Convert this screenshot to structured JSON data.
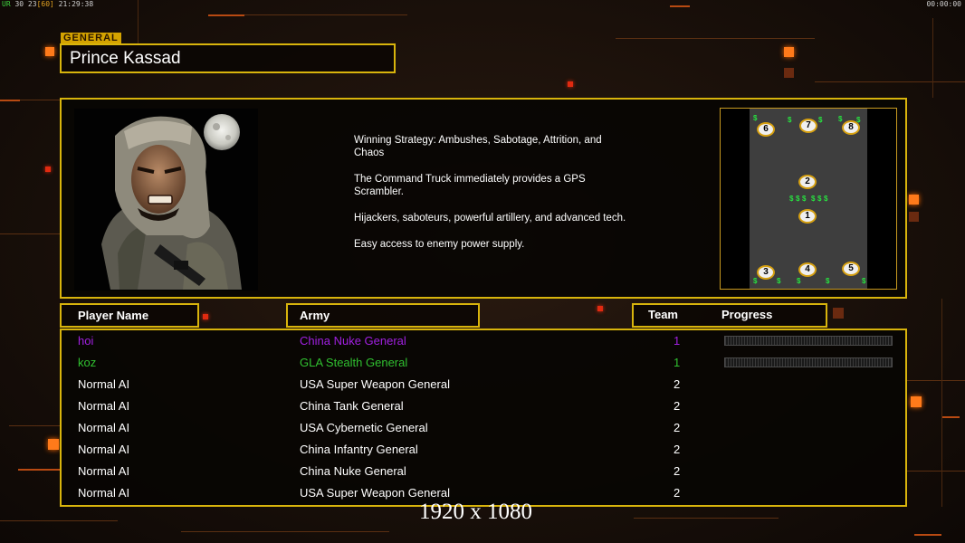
{
  "status_bar": {
    "left_prefix": "UR",
    "left_fps": "30 23",
    "left_fps_cap": "[60]",
    "left_time": "21:29:38",
    "right_timer": "00:00:00"
  },
  "general": {
    "tag": "GENERAL",
    "name": "Prince Kassad",
    "strategy_lines": [
      "Winning Strategy: Ambushes, Sabotage, Attrition, and Chaos",
      "The Command Truck immediately provides a GPS Scrambler.",
      "Hijackers, saboteurs, powerful artillery, and advanced tech.",
      "Easy access to enemy power supply."
    ]
  },
  "minimap": {
    "start_positions": [
      "6",
      "7",
      "8",
      "2",
      "1",
      "3",
      "4",
      "5"
    ],
    "cash_symbol": "$"
  },
  "headers": {
    "player_name": "Player Name",
    "army": "Army",
    "team": "Team",
    "progress": "Progress"
  },
  "players": [
    {
      "name": "hoi",
      "army": "China Nuke General",
      "team": "1",
      "color": "#a020e0",
      "show_progress": true
    },
    {
      "name": "koz",
      "army": "GLA Stealth General",
      "team": "1",
      "color": "#30c030",
      "show_progress": true
    },
    {
      "name": "Normal AI",
      "army": "USA Super Weapon General",
      "team": "2",
      "color": "#ffffff",
      "show_progress": false
    },
    {
      "name": "Normal AI",
      "army": "China Tank General",
      "team": "2",
      "color": "#ffffff",
      "show_progress": false
    },
    {
      "name": "Normal AI",
      "army": "USA Cybernetic General",
      "team": "2",
      "color": "#ffffff",
      "show_progress": false
    },
    {
      "name": "Normal AI",
      "army": "China Infantry General",
      "team": "2",
      "color": "#ffffff",
      "show_progress": false
    },
    {
      "name": "Normal AI",
      "army": "China Nuke General",
      "team": "2",
      "color": "#ffffff",
      "show_progress": false
    },
    {
      "name": "Normal AI",
      "army": "USA Super Weapon General",
      "team": "2",
      "color": "#ffffff",
      "show_progress": false
    }
  ],
  "resolution_label": "1920 x 1080",
  "colors": {
    "frame": "#d8b40c",
    "accent": "#ff7a1a",
    "cash": "#28e040"
  }
}
